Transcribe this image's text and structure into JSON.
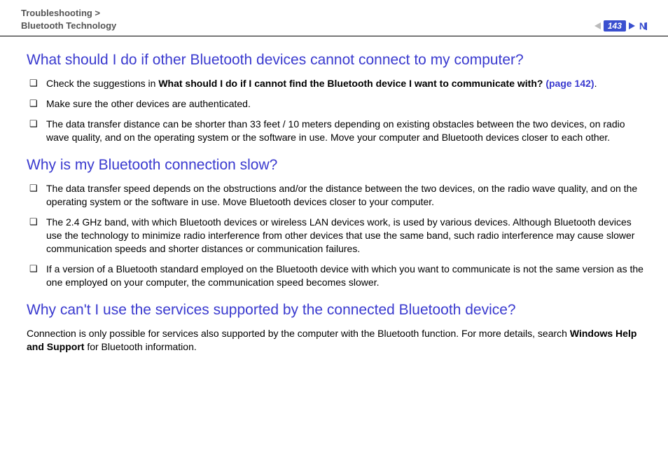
{
  "header": {
    "breadcrumb_l1": "Troubleshooting >",
    "breadcrumb_l2": "Bluetooth Technology",
    "page_number": "143",
    "n_label": "N"
  },
  "sections": [
    {
      "heading": "What should I do if other Bluetooth devices cannot connect to my computer?",
      "items": [
        {
          "pre": "Check the suggestions in ",
          "bold": "What should I do if I cannot find the Bluetooth device I want to communicate with? ",
          "link": "(page 142)",
          "post": "."
        },
        {
          "text": "Make sure the other devices are authenticated."
        },
        {
          "text": "The data transfer distance can be shorter than 33 feet / 10 meters depending on existing obstacles between the two devices, on radio wave quality, and on the operating system or the software in use. Move your computer and Bluetooth devices closer to each other."
        }
      ]
    },
    {
      "heading": "Why is my Bluetooth connection slow?",
      "items": [
        {
          "text": "The data transfer speed depends on the obstructions and/or the distance between the two devices, on the radio wave quality, and on the operating system or the software in use. Move Bluetooth devices closer to your computer."
        },
        {
          "text": "The 2.4 GHz band, with which Bluetooth devices or wireless LAN devices work, is used by various devices. Although Bluetooth devices use the technology to minimize radio interference from other devices that use the same band, such radio interference may cause slower communication speeds and shorter distances or communication failures."
        },
        {
          "text": "If a version of a Bluetooth standard employed on the Bluetooth device with which you want to communicate is not the same version as the one employed on your computer, the communication speed becomes slower."
        }
      ]
    },
    {
      "heading": "Why can't I use the services supported by the connected Bluetooth device?",
      "body": {
        "pre": "Connection is only possible for services also supported by the computer with the Bluetooth function. For more details, search ",
        "bold": "Windows Help and Support",
        "post": " for Bluetooth information."
      }
    }
  ]
}
